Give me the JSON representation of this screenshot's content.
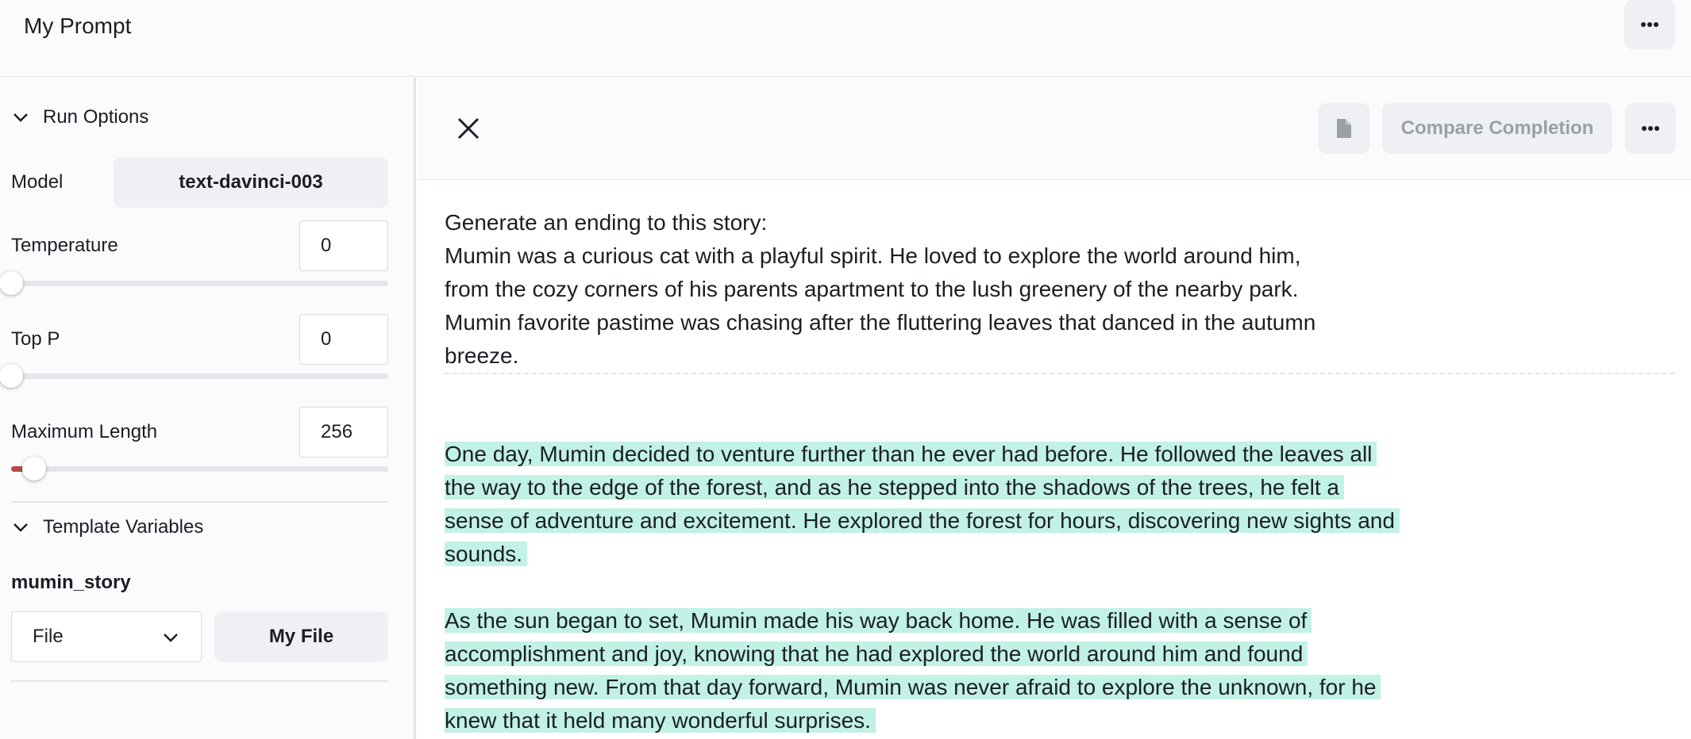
{
  "header": {
    "title": "My Prompt",
    "menu_icon": "more-horizontal-icon"
  },
  "sidebar": {
    "run_options_label": "Run Options",
    "model": {
      "label": "Model",
      "value": "text-davinci-003"
    },
    "temperature": {
      "label": "Temperature",
      "value": "0",
      "fraction": 0
    },
    "top_p": {
      "label": "Top P",
      "value": "0",
      "fraction": 0
    },
    "max_length": {
      "label": "Maximum Length",
      "value": "256",
      "fraction": 0.06
    },
    "template_variables_label": "Template Variables",
    "variable": {
      "name": "mumin_story",
      "type_selected": "File",
      "file_button": "My File"
    },
    "accent_color": "#b84a4a"
  },
  "toolbar": {
    "close_icon": "close-icon",
    "document_icon": "document-icon",
    "compare_label": "Compare Completion",
    "menu_icon": "more-horizontal-icon"
  },
  "prompt": {
    "lines": [
      "Generate an ending to this story:",
      "Mumin was a curious cat with a playful spirit. He loved to explore the world around him, from the cozy corners of his parents apartment to the lush greenery of the nearby park. Mumin favorite pastime was chasing after the fluttering leaves that danced in the autumn breeze."
    ]
  },
  "completion": {
    "highlight_color": "#c2f1e6",
    "paragraphs": [
      "One day, Mumin decided to venture further than he ever had before. He followed the leaves all the way to the edge of the forest, and as he stepped into the shadows of the trees, he felt a sense of adventure and excitement. He explored the forest for hours, discovering new sights and sounds.",
      "As the sun began to set, Mumin made his way back home. He was filled with a sense of accomplishment and joy, knowing that he had explored the world around him and found something new. From that day forward, Mumin was never afraid to explore the unknown, for he knew that it held many wonderful surprises."
    ]
  }
}
